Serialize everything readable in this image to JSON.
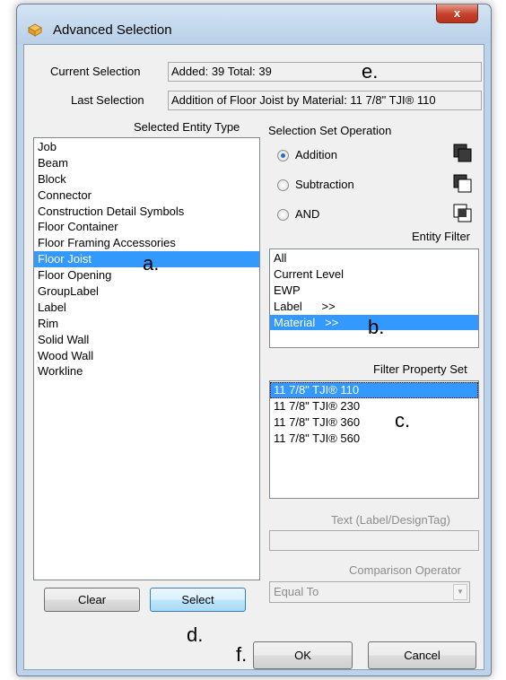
{
  "window": {
    "title": "Advanced Selection",
    "close_glyph": "x"
  },
  "current_selection": {
    "label": "Current Selection",
    "value": "Added: 39 Total: 39"
  },
  "last_selection": {
    "label": "Last Selection",
    "value": "Addition of Floor Joist by Material: 11 7/8\" TJI® 110"
  },
  "entity_type": {
    "label": "Selected Entity Type",
    "items": [
      "Job",
      "Beam",
      "Block",
      "Connector",
      "Construction Detail Symbols",
      "Floor Container",
      "Floor Framing Accessories",
      "Floor Joist",
      "Floor Opening",
      "GroupLabel",
      "Label",
      "Rim",
      "Solid Wall",
      "Wood Wall",
      "Workline"
    ],
    "selected": "Floor Joist"
  },
  "operation": {
    "label": "Selection Set Operation",
    "options": [
      "Addition",
      "Subtraction",
      "AND"
    ],
    "selected": "Addition"
  },
  "entity_filter": {
    "label": "Entity Filter",
    "items": [
      "All",
      "Current Level",
      "EWP",
      "Label      >>",
      "Material   >>"
    ],
    "selected": "Material   >>"
  },
  "filter_property_set": {
    "label": "Filter Property Set",
    "items": [
      "11 7/8\" TJI® 110",
      "11 7/8\" TJI® 230",
      "11 7/8\" TJI® 360",
      "11 7/8\" TJI® 560"
    ],
    "selected": "11 7/8\" TJI® 110"
  },
  "text_filter": {
    "label": "Text (Label/DesignTag)",
    "value": ""
  },
  "comparison": {
    "label": "Comparison Operator",
    "value": "Equal To"
  },
  "buttons": {
    "clear": "Clear",
    "select": "Select",
    "ok": "OK",
    "cancel": "Cancel"
  },
  "annotations": {
    "a": "a.",
    "b": "b.",
    "c": "c.",
    "d": "d.",
    "e": "e.",
    "f": "f."
  }
}
